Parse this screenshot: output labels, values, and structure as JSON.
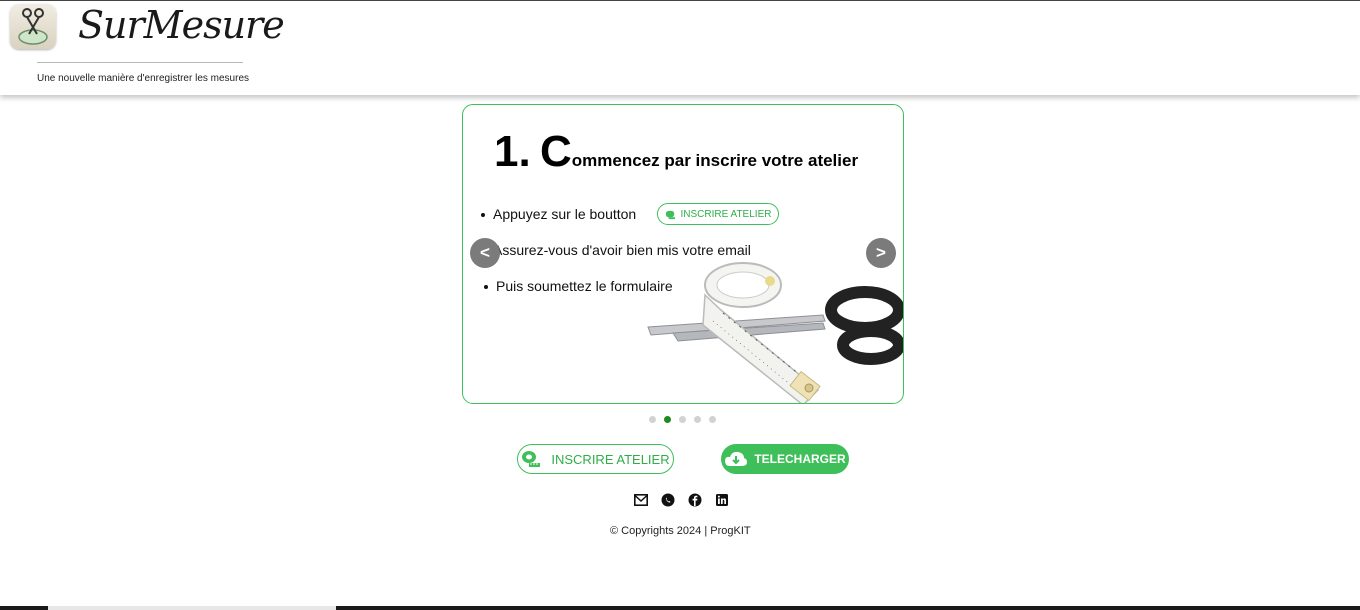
{
  "header": {
    "brand": "SurMesure",
    "tagline": "Une nouvelle manière d'enregistrer les mesures"
  },
  "slide": {
    "number": "1.",
    "title_cap": "C",
    "title_rest": "ommencez par inscrire votre atelier",
    "bullets": [
      "Appuyez sur le boutton",
      "Assurez-vous d'avoir bien mis votre email",
      "Puis soumettez le formulaire"
    ],
    "inline_button": "INSCRIRE ATELIER",
    "prev_label": "<",
    "next_label": ">",
    "image_icon": "tape-measure-scissors-image"
  },
  "pagination": {
    "count": 5,
    "active_index": 1
  },
  "actions": {
    "register_label": "INSCRIRE ATELIER",
    "download_label": "TELECHARGER"
  },
  "social": {
    "icons": [
      "mail-icon",
      "whatsapp-icon",
      "facebook-icon",
      "linkedin-icon"
    ]
  },
  "footer": {
    "copyright": "Copyrights 2024",
    "separator": "|",
    "company": "ProgKIT"
  },
  "colors": {
    "accent": "#3fbf5a",
    "dot_active": "#1f8a1f",
    "nav_button": "#7b7b7b"
  }
}
